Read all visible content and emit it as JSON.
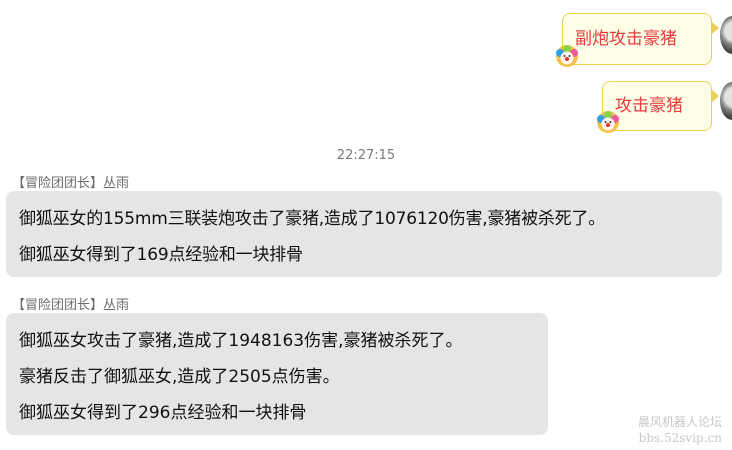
{
  "outgoing": [
    {
      "text": "副炮攻击豪猪"
    },
    {
      "text": "攻击豪猪"
    }
  ],
  "timestamp": "22:27:15",
  "incoming": [
    {
      "sender_role": "【冒险团团长】",
      "sender_name": "丛雨",
      "lines": [
        "御狐巫女的155mm三联装炮攻击了豪猪,造成了1076120伤害,豪猪被杀死了。",
        "御狐巫女得到了169点经验和一块排骨"
      ]
    },
    {
      "sender_role": "【冒险团团长】",
      "sender_name": "丛雨",
      "lines": [
        "御狐巫女攻击了豪猪,造成了1948163伤害,豪猪被杀死了。",
        "豪猪反击了御狐巫女,造成了2505点伤害。",
        "御狐巫女得到了296点经验和一块排骨"
      ]
    }
  ],
  "watermark": {
    "line1": "晨风机器人论坛",
    "line2": "bbs.52svip.cn"
  },
  "icons": {
    "outgoing_decoration": "clown-icon",
    "user_avatar": "avatar-icon"
  },
  "colors": {
    "outgoing_text": "#e53b3b",
    "outgoing_bubble": "#fdfde8",
    "outgoing_border": "#f0cf55",
    "incoming_bubble": "#e5e5e5"
  }
}
